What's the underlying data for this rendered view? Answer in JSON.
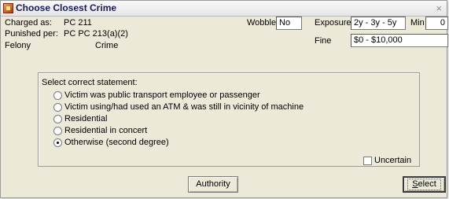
{
  "window": {
    "title": "Choose Closest Crime",
    "close_glyph": "×"
  },
  "header": {
    "charged_as_label": "Charged as:",
    "charged_as_value": "PC 211",
    "punished_per_label": "Punished per:",
    "punished_per_value": "PC PC 213(a)(2)",
    "felony_label": "Felony",
    "crime_label": "Crime",
    "wobble_label": "Wobble",
    "wobble_value": "No",
    "exposure_label": "Exposure",
    "exposure_value": "2y - 3y - 5y",
    "min_label": "Min",
    "min_value": "0",
    "fine_label": "Fine",
    "fine_value": "$0 - $10,000"
  },
  "statement": {
    "prompt": "Select correct statement:",
    "options": [
      {
        "label": "Victim was public transport employee or passenger",
        "checked": false
      },
      {
        "label": "Victim using/had used an ATM & was still in vicinity of machine",
        "checked": false
      },
      {
        "label": "Residential",
        "checked": false
      },
      {
        "label": "Residential in concert",
        "checked": false
      },
      {
        "label": "Otherwise (second degree)",
        "checked": true
      }
    ],
    "uncertain_label": "Uncertain",
    "uncertain_checked": false
  },
  "buttons": {
    "authority_label": "Authority",
    "select_first_letter": "S",
    "select_rest": "elect"
  },
  "icons": {
    "app": "app-icon",
    "close": "close-icon"
  }
}
